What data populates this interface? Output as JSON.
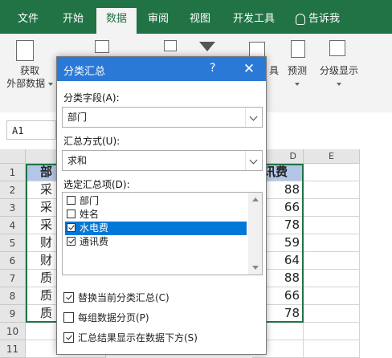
{
  "ribbon": {
    "tabs": [
      "文件",
      "开始",
      "数据",
      "审阅",
      "视图",
      "开发工具"
    ],
    "active_tab": "数据",
    "tell_me": "告诉我",
    "get_data_line1": "获取",
    "get_data_line2": "外部数据",
    "tools_fragment": "具",
    "forecast_label": "预测",
    "outline_label": "分级显示"
  },
  "name_box": "A1",
  "sheet": {
    "columns": [
      "",
      "",
      "",
      "D",
      "E"
    ],
    "rows": [
      "1",
      "2",
      "3",
      "4",
      "5",
      "6",
      "7",
      "8",
      "9",
      "10",
      "11"
    ],
    "col_a_fragments": [
      "部",
      "采",
      "采",
      "采",
      "财",
      "财",
      "质",
      "质",
      "质"
    ],
    "col_d_header": "讯费",
    "col_d_values": [
      "88",
      "66",
      "78",
      "59",
      "64",
      "88",
      "66",
      "78"
    ]
  },
  "dialog": {
    "title": "分类汇总",
    "help": "?",
    "close": "✕",
    "field_label": "分类字段(A):",
    "field_value": "部门",
    "func_label": "汇总方式(U):",
    "func_value": "求和",
    "items_label": "选定汇总项(D):",
    "items": [
      {
        "label": "部门",
        "checked": false,
        "selected": false
      },
      {
        "label": "姓名",
        "checked": false,
        "selected": false
      },
      {
        "label": "水电费",
        "checked": true,
        "selected": true
      },
      {
        "label": "通讯费",
        "checked": true,
        "selected": false
      }
    ],
    "opt_replace": "替换当前分类汇总(C)",
    "opt_replace_checked": true,
    "opt_pagebreak": "每组数据分页(P)",
    "opt_pagebreak_checked": false,
    "opt_below": "汇总结果显示在数据下方(S)",
    "opt_below_checked": true
  },
  "colors": {
    "ribbon_green": "#217346",
    "dialog_blue": "#2b79d7",
    "header_fill": "#b4c6e7",
    "selection_blue": "#0078d7"
  }
}
